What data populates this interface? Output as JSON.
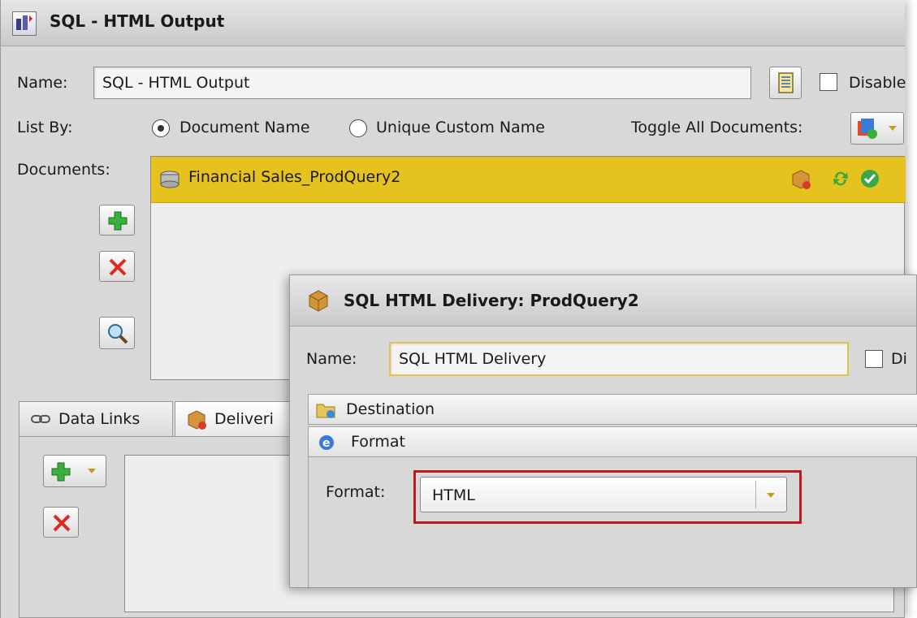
{
  "window": {
    "title": "SQL - HTML Output"
  },
  "name_row": {
    "label": "Name:",
    "value": "SQL - HTML Output",
    "disable_label": "Disable"
  },
  "list_by": {
    "label": "List By:",
    "option1": "Document Name",
    "option2": "Unique Custom Name",
    "toggle_label": "Toggle All Documents:"
  },
  "documents": {
    "label": "Documents:",
    "items": [
      {
        "name": "Financial Sales_ProdQuery2"
      }
    ]
  },
  "tabs": [
    {
      "label": "Data Links"
    },
    {
      "label": "Deliveri"
    }
  ],
  "dialog": {
    "title": "SQL HTML Delivery: ProdQuery2",
    "name_label": "Name:",
    "name_value": "SQL HTML Delivery",
    "disable_label": "Di",
    "sections": [
      {
        "label": "Destination"
      },
      {
        "label": "Format"
      }
    ],
    "format_label": "Format:",
    "format_value": "HTML"
  },
  "colors": {
    "selected_row": "#e6c21e",
    "highlight_box": "#c0181d"
  }
}
